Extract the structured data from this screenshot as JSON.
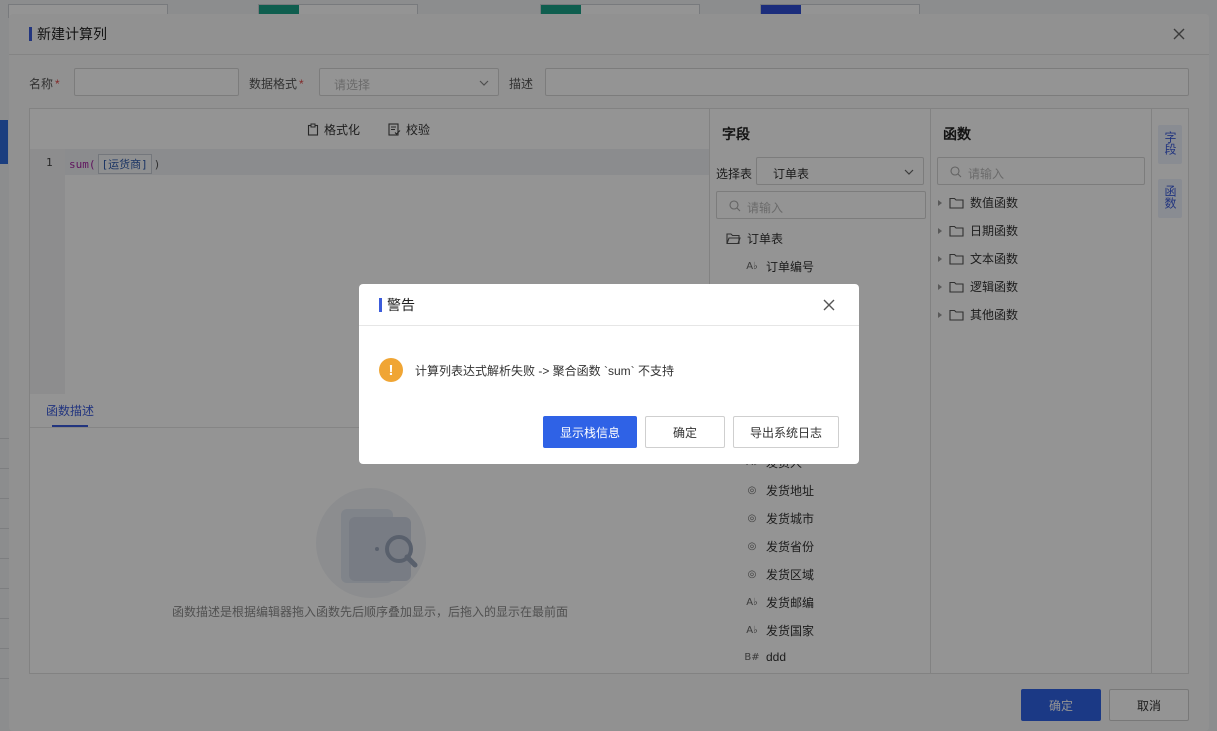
{
  "dialog": {
    "title": "新建计算列",
    "name_label": "名称",
    "required_mark": "*",
    "format_label": "数据格式",
    "format_placeholder": "请选择",
    "desc_label": "描述",
    "name_value": "",
    "desc_value": ""
  },
  "editor": {
    "format_label": "格式化",
    "validate_label": "校验",
    "line_number": "1",
    "code_fn": "sum(",
    "code_field": "[运货商]",
    "code_close": ")"
  },
  "description": {
    "tab_label": "函数描述",
    "empty_text": "函数描述是根据编辑器拖入函数先后顺序叠加显示，后拖入的显示在最前面"
  },
  "fields": {
    "title": "字段",
    "select_label": "选择表",
    "selected_table": "订单表",
    "search_placeholder": "请输入",
    "root": "订单表",
    "items": [
      {
        "icon": "text-type-icon",
        "glyph": "A♭",
        "label": "订单编号"
      },
      {
        "icon": "text-type-icon",
        "glyph": "A♭",
        "label": "发货人"
      },
      {
        "icon": "geo-type-icon",
        "glyph": "◎",
        "label": "发货地址"
      },
      {
        "icon": "geo-type-icon",
        "glyph": "◎",
        "label": "发货城市"
      },
      {
        "icon": "geo-type-icon",
        "glyph": "◎",
        "label": "发货省份"
      },
      {
        "icon": "geo-type-icon",
        "glyph": "◎",
        "label": "发货区域"
      },
      {
        "icon": "text-type-icon",
        "glyph": "A♭",
        "label": "发货邮编"
      },
      {
        "icon": "text-type-icon",
        "glyph": "A♭",
        "label": "发货国家"
      },
      {
        "icon": "number-type-icon",
        "glyph": "B#",
        "label": "ddd"
      }
    ]
  },
  "functions": {
    "title": "函数",
    "search_placeholder": "请输入",
    "groups": [
      "数值函数",
      "日期函数",
      "文本函数",
      "逻辑函数",
      "其他函数"
    ]
  },
  "side_tabs": [
    "字段",
    "函数"
  ],
  "footer": {
    "confirm_label": "确定",
    "cancel_label": "取消"
  },
  "alert": {
    "title": "警告",
    "message": "计算列表达式解析失败 -> 聚合函数 `sum` 不支持",
    "stack_button": "显示栈信息",
    "ok_button": "确定",
    "export_button": "导出系统日志"
  },
  "colors": {
    "accent": "#3c5cdb",
    "primary_button": "#2f62e6",
    "warning": "#f0a534"
  }
}
